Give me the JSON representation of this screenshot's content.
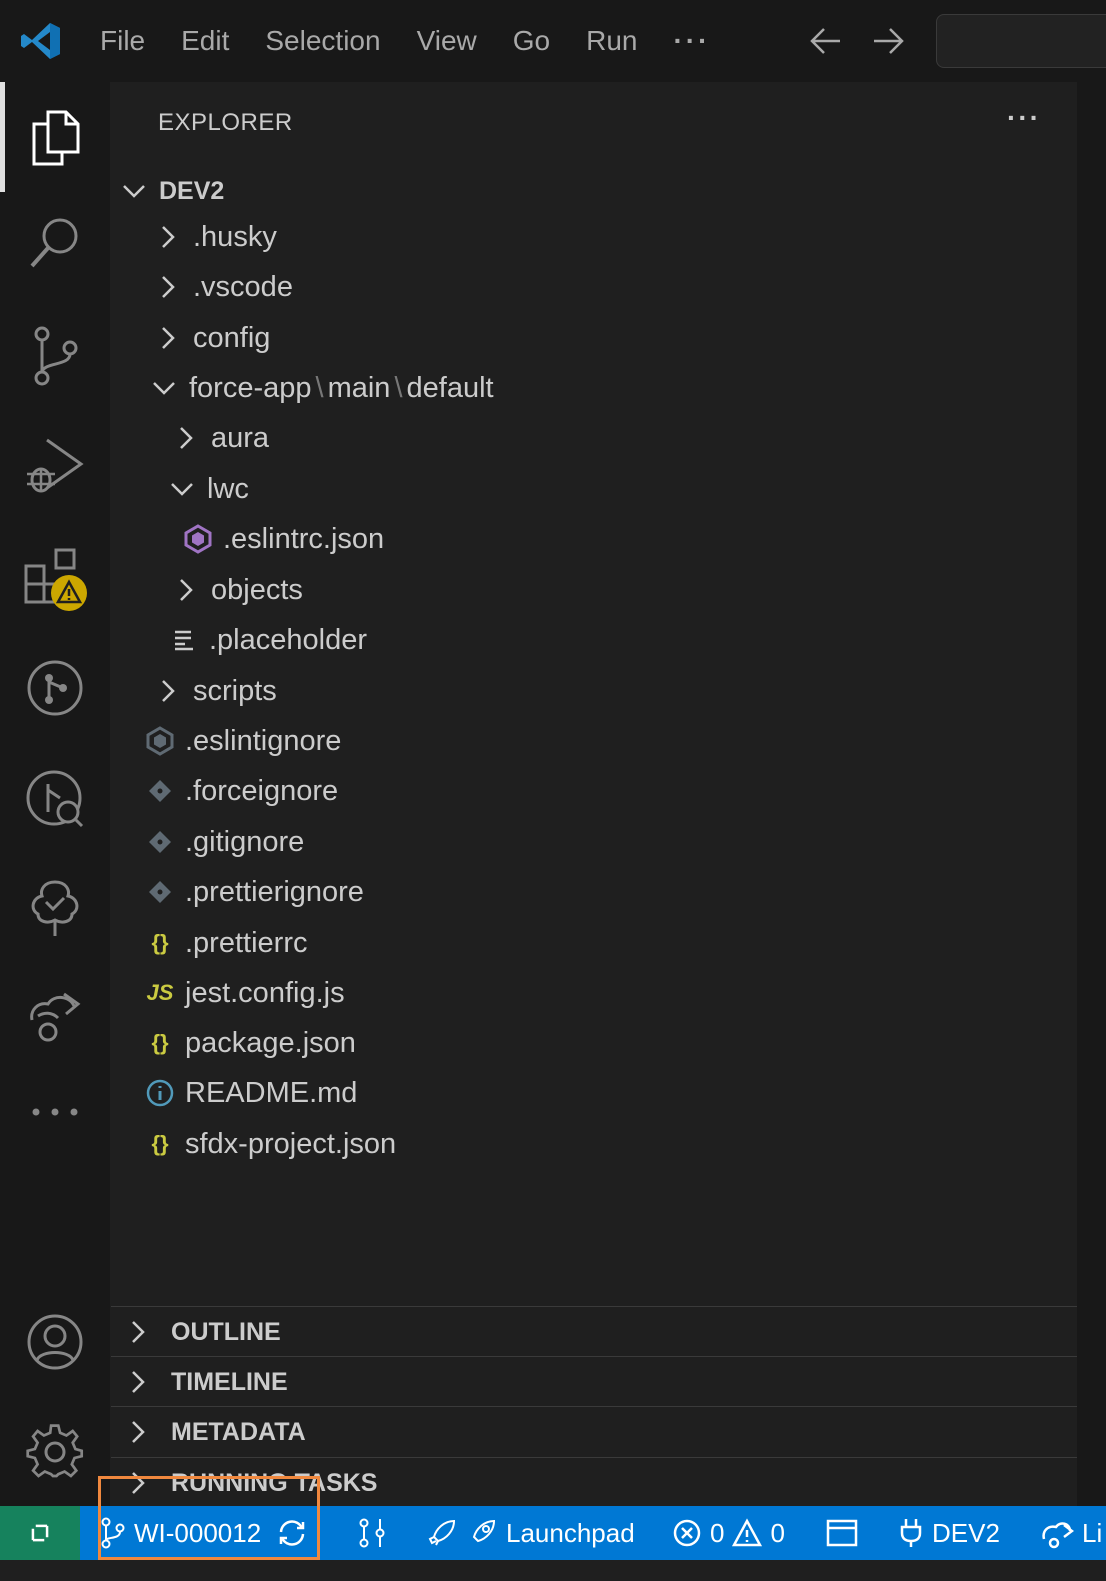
{
  "menu": {
    "items": [
      "File",
      "Edit",
      "Selection",
      "View",
      "Go",
      "Run"
    ],
    "more": "···"
  },
  "explorer": {
    "title": "EXPLORER",
    "more": "···",
    "root": "DEV2",
    "tree": [
      {
        "label": ".husky",
        "type": "folder",
        "expanded": false
      },
      {
        "label": ".vscode",
        "type": "folder",
        "expanded": false
      },
      {
        "label": "config",
        "type": "folder",
        "expanded": false
      },
      {
        "label": "force-app",
        "sep1": "\\",
        "label2": "main",
        "sep2": "\\",
        "label3": "default",
        "type": "folder",
        "expanded": true
      },
      {
        "label": "aura",
        "type": "folder",
        "expanded": false
      },
      {
        "label": "lwc",
        "type": "folder",
        "expanded": true
      },
      {
        "label": ".eslintrc.json",
        "type": "file",
        "icon": "eslint-icon"
      },
      {
        "label": "objects",
        "type": "folder",
        "expanded": false
      },
      {
        "label": ".placeholder",
        "type": "file",
        "icon": "text-file-icon"
      },
      {
        "label": "scripts",
        "type": "folder",
        "expanded": false
      },
      {
        "label": ".eslintignore",
        "type": "file",
        "icon": "eslint-ignore-icon"
      },
      {
        "label": ".forceignore",
        "type": "file",
        "icon": "git-diamond-icon"
      },
      {
        "label": ".gitignore",
        "type": "file",
        "icon": "git-diamond-icon"
      },
      {
        "label": ".prettierignore",
        "type": "file",
        "icon": "git-diamond-icon"
      },
      {
        "label": ".prettierrc",
        "type": "file",
        "icon": "json-braces-icon",
        "glyph": "{}"
      },
      {
        "label": "jest.config.js",
        "type": "file",
        "icon": "js-icon",
        "glyph": "JS"
      },
      {
        "label": "package.json",
        "type": "file",
        "icon": "json-braces-icon",
        "glyph": "{}"
      },
      {
        "label": "README.md",
        "type": "file",
        "icon": "info-icon"
      },
      {
        "label": "sfdx-project.json",
        "type": "file",
        "icon": "json-braces-icon",
        "glyph": "{}"
      }
    ]
  },
  "panels": [
    "OUTLINE",
    "TIMELINE",
    "METADATA",
    "RUNNING TASKS"
  ],
  "statusbar": {
    "branch": "WI-000012",
    "launchpad": "Launchpad",
    "errors": "0",
    "warnings": "0",
    "org": "DEV2",
    "cut": "Li"
  },
  "colors": {
    "status_bar": "#0078d4",
    "remote": "#16825d",
    "highlight": "#f0883e",
    "json_icon": "#cbcb41",
    "eslint_icon": "#a074c4",
    "info_icon": "#519aba",
    "warning_badge": "#cca700"
  }
}
